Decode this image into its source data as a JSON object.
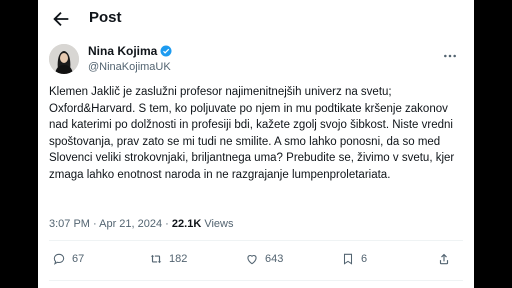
{
  "header": {
    "title": "Post"
  },
  "author": {
    "name": "Nina Kojima",
    "handle": "@NinaKojimaUK"
  },
  "tweet": {
    "text": "Klemen Jaklič je zaslužni profesor najimenitnejših univerz na svetu; Oxford&Harvard. S tem, ko poljuvate po njem in mu podtikate kršenje zakonov nad katerimi po dolžnosti in profesiji bdi, kažete zgolj svojo šibkost. Niste vredni spoštovanja, prav zato se mi tudi ne smilite. A smo lahko ponosni, da so med Slovenci veliki strokovnjaki, briljantnega uma? Prebudite se, živimo v svetu, kjer zmaga lahko enotnost naroda in ne razgrajanje lumpenproletariata."
  },
  "meta": {
    "timestamp": "3:07 PM · Apr 21, 2024 · ",
    "views_count": "22.1K",
    "views_label": " Views"
  },
  "actions": {
    "replies": "67",
    "reposts": "182",
    "likes": "643",
    "bookmarks": "6"
  },
  "colors": {
    "text": "#0f1419",
    "secondary": "#536471",
    "verified": "#1d9bf0"
  },
  "icons": [
    "back-arrow-icon",
    "verified-badge-icon",
    "more-icon",
    "reply-icon",
    "repost-icon",
    "like-icon",
    "bookmark-icon",
    "share-icon"
  ]
}
